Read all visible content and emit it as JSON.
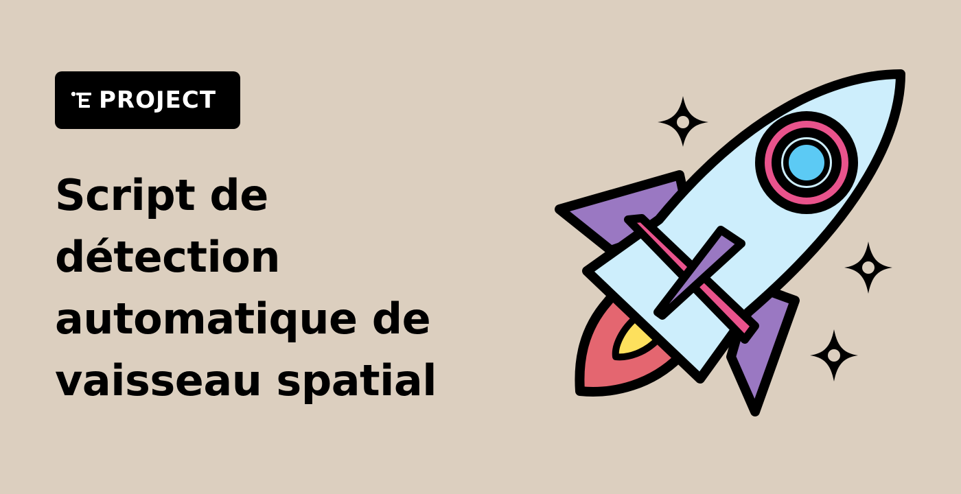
{
  "badge": {
    "icon": "project-tree-icon",
    "label": "PROJECT"
  },
  "title": "Script de détection automatique de vaisseau spatial",
  "illustration": {
    "icon": "rocket-icon",
    "sparkles": [
      "sparkle-icon",
      "sparkle-icon",
      "sparkle-icon"
    ]
  },
  "colors": {
    "background": "#dccfbf",
    "badge_bg": "#000000",
    "badge_text": "#ffffff",
    "title_text": "#000000",
    "rocket_body": "#cdeefc",
    "rocket_fin": "#9a78c2",
    "rocket_accent": "#e9538c",
    "window_glass": "#5ccaf4",
    "flame_outer": "#e46670",
    "flame_inner": "#fde05d"
  }
}
